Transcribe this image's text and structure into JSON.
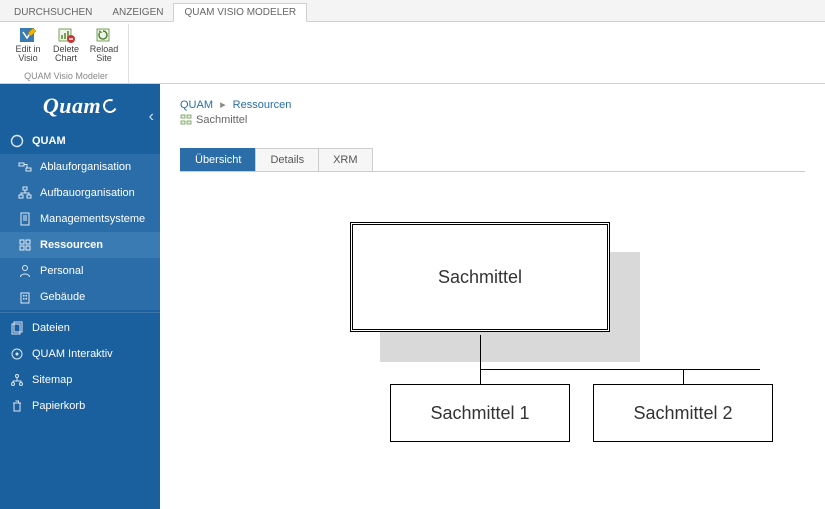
{
  "ribbon": {
    "tabs": [
      "DURCHSUCHEN",
      "ANZEIGEN",
      "QUAM VISIO MODELER"
    ],
    "active_tab": 2,
    "group_label": "QUAM Visio Modeler",
    "buttons": [
      {
        "label1": "Edit in",
        "label2": "Visio"
      },
      {
        "label1": "Delete",
        "label2": "Chart"
      },
      {
        "label1": "Reload",
        "label2": "Site"
      }
    ]
  },
  "brand": "Quam",
  "nav": {
    "top": "QUAM",
    "items": [
      "Ablauforganisation",
      "Aufbauorganisation",
      "Managementsysteme",
      "Ressourcen",
      "Personal",
      "Gebäude"
    ],
    "active_index": 3,
    "secondary": [
      "Dateien",
      "QUAM Interaktiv",
      "Sitemap",
      "Papierkorb"
    ]
  },
  "breadcrumb": {
    "root": "QUAM",
    "section": "Ressourcen",
    "page": "Sachmittel"
  },
  "content_tabs": {
    "items": [
      "Übersicht",
      "Details",
      "XRM"
    ],
    "active": 0
  },
  "diagram": {
    "root": "Sachmittel",
    "children": [
      "Sachmittel 1",
      "Sachmittel 2"
    ]
  }
}
